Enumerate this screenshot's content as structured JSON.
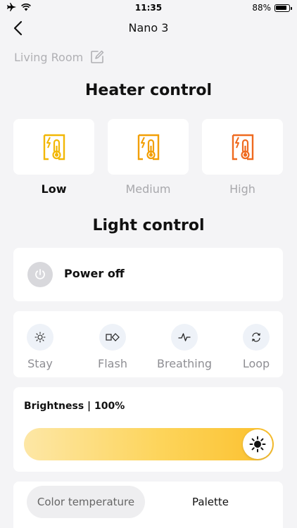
{
  "status_bar": {
    "time": "11:35",
    "battery": "88%",
    "battery_level": 0.88
  },
  "nav": {
    "title": "Nano 3"
  },
  "room": {
    "name": "Living Room"
  },
  "heater": {
    "title": "Heater control",
    "levels": [
      {
        "label": "Low",
        "color": "#f2b705",
        "selected": true
      },
      {
        "label": "Medium",
        "color": "#f29f05",
        "selected": false
      },
      {
        "label": "High",
        "color": "#ef6a1f",
        "selected": false
      }
    ]
  },
  "light": {
    "title": "Light control",
    "power_label": "Power off",
    "modes": [
      {
        "label": "Stay",
        "icon": "sun-small-icon"
      },
      {
        "label": "Flash",
        "icon": "flash-mode-icon"
      },
      {
        "label": "Breathing",
        "icon": "pulse-icon"
      },
      {
        "label": "Loop",
        "icon": "loop-icon"
      }
    ],
    "brightness_label": "Brightness | 100%",
    "brightness_value": 100
  },
  "tabs": {
    "color_temperature": "Color temperature",
    "palette": "Palette"
  },
  "colors": {
    "accent": "#fbc02d",
    "background": "#f4f4f6",
    "muted": "#8e8e93"
  }
}
